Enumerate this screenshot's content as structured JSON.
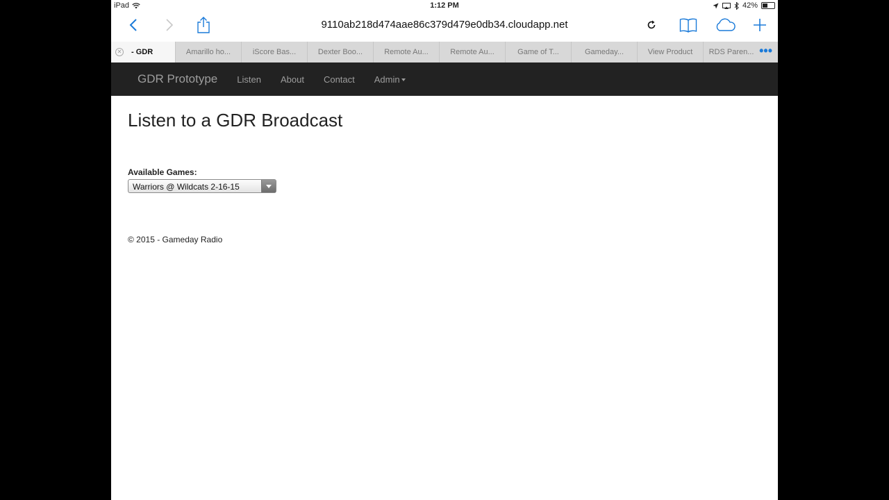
{
  "status_bar": {
    "device": "iPad",
    "time": "1:12 PM",
    "battery": "42%",
    "battery_level": 0.42
  },
  "toolbar": {
    "url": "9110ab218d474aae86c379d479e0db34.cloudapp.net"
  },
  "tabs": [
    {
      "label": "- GDR",
      "active": true
    },
    {
      "label": "Amarillo ho..."
    },
    {
      "label": "iScore Bas..."
    },
    {
      "label": "Dexter Boo..."
    },
    {
      "label": "Remote Au..."
    },
    {
      "label": "Remote Au..."
    },
    {
      "label": "Game of T..."
    },
    {
      "label": "Gameday..."
    },
    {
      "label": "View Product"
    },
    {
      "label": "RDS Paren..."
    }
  ],
  "tabs_more": "•••",
  "navbar": {
    "brand": "GDR Prototype",
    "links": [
      "Listen",
      "About",
      "Contact",
      "Admin"
    ]
  },
  "main": {
    "title": "Listen to a GDR Broadcast",
    "games_label": "Available Games:",
    "selected_game": "Warriors @ Wildcats 2-16-15"
  },
  "footer": {
    "text": "© 2015 - Gameday Radio"
  },
  "colors": {
    "accent": "#1a7ad9",
    "navbar_bg": "#222222",
    "navbar_text": "#9d9d9d"
  }
}
